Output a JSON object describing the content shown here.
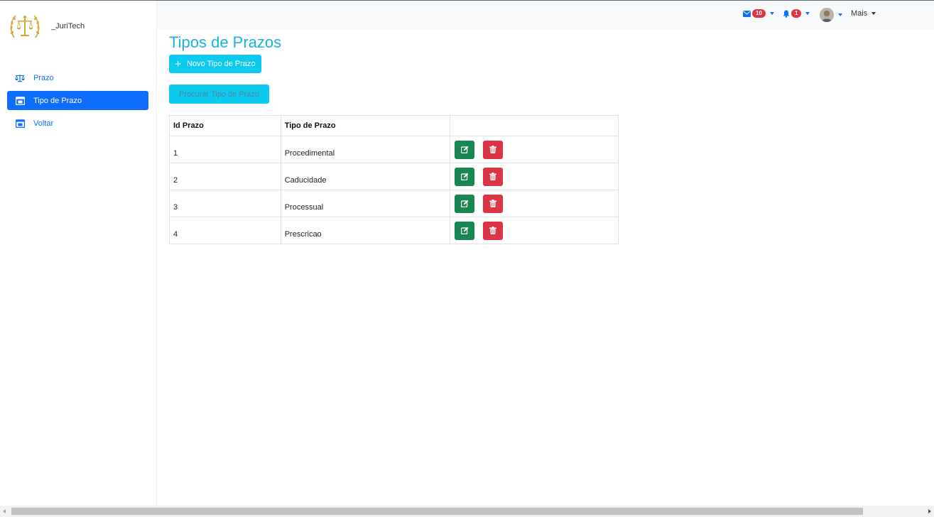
{
  "brand": {
    "name": "_JuriTech",
    "logo_icon": "scales-laurel-icon"
  },
  "sidebar": {
    "items": [
      {
        "label": "Prazo",
        "icon": "scale-icon",
        "active": false
      },
      {
        "label": "Tipo de Prazo",
        "icon": "calendar-icon",
        "active": true
      },
      {
        "label": "Voltar",
        "icon": "calendar-icon",
        "active": false
      }
    ]
  },
  "topbar": {
    "messages_count": "10",
    "alerts_count": "1",
    "more_label": "Mais"
  },
  "page": {
    "title": "Tipos de Prazos",
    "new_button": "Novo Tipo de Prazo",
    "search_button": "Procurar Tipo de Prazo"
  },
  "table": {
    "headers": [
      "Id Prazo",
      "Tipo de Prazo",
      ""
    ],
    "rows": [
      {
        "id": "1",
        "tipo": "Procedimental"
      },
      {
        "id": "2",
        "tipo": "Caducidade"
      },
      {
        "id": "3",
        "tipo": "Processual"
      },
      {
        "id": "4",
        "tipo": "Prescricao"
      }
    ]
  },
  "colors": {
    "primary": "#0d6efd",
    "info": "#0dcaf0",
    "title": "#17b4de",
    "success": "#198754",
    "danger": "#dc3545"
  }
}
